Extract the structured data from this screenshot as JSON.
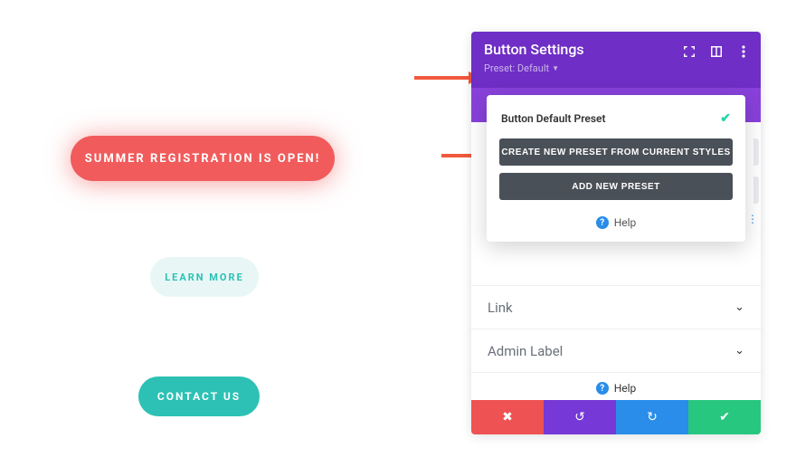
{
  "buttons": {
    "red_label": "SUMMER REGISTRATION IS OPEN!",
    "learn_label": "LEARN MORE",
    "contact_label": "CONTACT US"
  },
  "panel": {
    "title": "Button Settings",
    "preset_label": "Preset: Default",
    "help_label": "Help"
  },
  "preset_popup": {
    "default_item": "Button Default Preset",
    "create_btn": "CREATE NEW PRESET FROM CURRENT STYLES",
    "add_btn": "ADD NEW PRESET",
    "help_label": "Help"
  },
  "accordion": {
    "link": "Link",
    "admin_label": "Admin Label"
  }
}
